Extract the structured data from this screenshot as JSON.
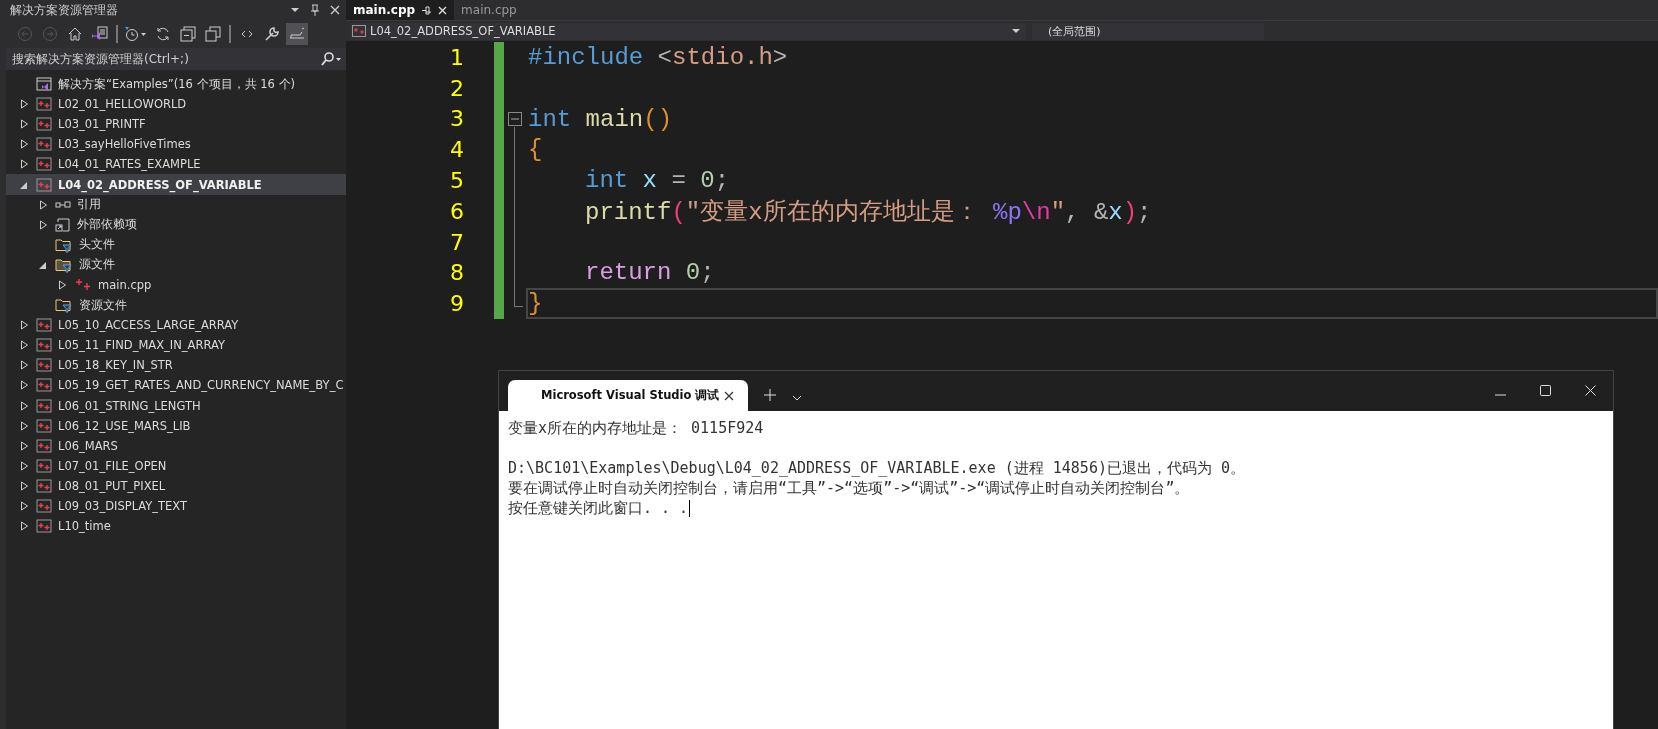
{
  "solution_explorer": {
    "title": "解决方案资源管理器",
    "toolbar": [
      {
        "kind": "back",
        "disabled": true,
        "on": false
      },
      {
        "kind": "forward",
        "disabled": true,
        "on": false
      },
      {
        "kind": "home",
        "on": false
      },
      {
        "kind": "solution",
        "on": false
      },
      {
        "kind": "history",
        "on": false,
        "separator_before": true
      },
      {
        "kind": "sync",
        "on": false
      },
      {
        "kind": "collapse",
        "on": false
      },
      {
        "kind": "copy",
        "on": false
      },
      {
        "kind": "code",
        "on": false,
        "separator_before": true
      },
      {
        "kind": "wrench",
        "on": false
      },
      {
        "kind": "preview",
        "on": true
      }
    ],
    "search": {
      "placeholder": "搜索解决方案资源管理器(Ctrl+;)"
    },
    "solution": {
      "label": "解决方案“Examples”(16 个项目，共 16 个)",
      "projects": [
        {
          "kind": "project",
          "label": "L02_01_HELLOWORLD",
          "expanded": false,
          "selected": false
        },
        {
          "kind": "project",
          "label": "L03_01_PRINTF",
          "expanded": false,
          "selected": false
        },
        {
          "kind": "project",
          "label": "L03_sayHelloFiveTimes",
          "expanded": false,
          "selected": false
        },
        {
          "kind": "project",
          "label": "L04_01_RATES_EXAMPLE",
          "expanded": false,
          "selected": false
        },
        {
          "kind": "project",
          "label": "L04_02_ADDRESS_OF_VARIABLE",
          "expanded": true,
          "selected": true,
          "children": [
            {
              "kind": "references",
              "label": "引用",
              "expanded": false,
              "selected": false
            },
            {
              "kind": "external",
              "label": "外部依赖项",
              "expanded": false,
              "selected": false
            },
            {
              "kind": "filter",
              "label": "头文件",
              "selected": false
            },
            {
              "kind": "filter",
              "label": "源文件",
              "expanded": true,
              "selected": false,
              "children": [
                {
                  "kind": "cpp",
                  "label": "main.cpp",
                  "expanded": false,
                  "selected": false
                }
              ]
            },
            {
              "kind": "filter",
              "label": "资源文件",
              "selected": false
            }
          ]
        },
        {
          "kind": "project",
          "label": "L05_10_ACCESS_LARGE_ARRAY",
          "expanded": false,
          "selected": false
        },
        {
          "kind": "project",
          "label": "L05_11_FIND_MAX_IN_ARRAY",
          "expanded": false,
          "selected": false
        },
        {
          "kind": "project",
          "label": "L05_18_KEY_IN_STR",
          "expanded": false,
          "selected": false
        },
        {
          "kind": "project",
          "label": "L05_19_GET_RATES_AND_CURRENCY_NAME_BY_C",
          "expanded": false,
          "selected": false
        },
        {
          "kind": "project",
          "label": "L06_01_STRING_LENGTH",
          "expanded": false,
          "selected": false
        },
        {
          "kind": "project",
          "label": "L06_12_USE_MARS_LIB",
          "expanded": false,
          "selected": false
        },
        {
          "kind": "project",
          "label": "L06_MARS",
          "expanded": false,
          "selected": false
        },
        {
          "kind": "project",
          "label": "L07_01_FILE_OPEN",
          "expanded": false,
          "selected": false
        },
        {
          "kind": "project",
          "label": "L08_01_PUT_PIXEL",
          "expanded": false,
          "selected": false
        },
        {
          "kind": "project",
          "label": "L09_03_DISPLAY_TEXT",
          "expanded": false,
          "selected": false
        },
        {
          "kind": "project",
          "label": "L10_time",
          "expanded": false,
          "selected": false
        }
      ]
    }
  },
  "editor": {
    "tabs": [
      {
        "label": "main.cpp",
        "selected": true
      },
      {
        "label": "main.cpp",
        "selected": false
      }
    ],
    "nav": {
      "project": "L04_02_ADDRESS_OF_VARIABLE",
      "scope": "(全局范围)"
    },
    "lines": [
      {
        "number": "1",
        "current": false,
        "indented": false,
        "tokens": [
          {
            "kind": "preproc",
            "text": "#include"
          },
          {
            "kind": "op",
            "text": " <"
          },
          {
            "kind": "header",
            "text": "stdio.h"
          },
          {
            "kind": "op",
            "text": ">"
          }
        ]
      },
      {
        "number": "2",
        "current": false
      },
      {
        "number": "3",
        "current": false,
        "indented": false,
        "collapsible": true,
        "tokens": [
          {
            "kind": "kw",
            "text": "int"
          },
          {
            "kind": "fn",
            "text": " main"
          },
          {
            "kind": "brace",
            "text": "()"
          }
        ]
      },
      {
        "number": "4",
        "current": false,
        "indented": false,
        "tokens": [
          {
            "kind": "brace",
            "text": "{"
          }
        ]
      },
      {
        "number": "5",
        "current": false,
        "indented": true,
        "tokens": [
          {
            "kind": "kw",
            "text": "int"
          },
          {
            "kind": "var",
            "text": " x"
          },
          {
            "kind": "op",
            "text": " ="
          },
          {
            "kind": "num",
            "text": " 0"
          },
          {
            "kind": "op",
            "text": ";"
          }
        ]
      },
      {
        "number": "6",
        "current": false,
        "indented": true,
        "tokens": [
          {
            "kind": "fn",
            "text": "printf"
          },
          {
            "kind": "paren",
            "text": "("
          },
          {
            "kind": "str",
            "text": "\"变量x所在的内存地址是："
          },
          {
            "kind": "fmt",
            "text": " %p"
          },
          {
            "kind": "esc",
            "text": "\\n"
          },
          {
            "kind": "str",
            "text": "\""
          },
          {
            "kind": "op",
            "text": ", &"
          },
          {
            "kind": "var",
            "text": "x"
          },
          {
            "kind": "paren",
            "text": ")"
          },
          {
            "kind": "op",
            "text": ";"
          }
        ]
      },
      {
        "number": "7",
        "current": false
      },
      {
        "number": "8",
        "current": false,
        "indented": true,
        "tokens": [
          {
            "kind": "ret",
            "text": "return"
          },
          {
            "kind": "num",
            "text": " 0"
          },
          {
            "kind": "op",
            "text": ";"
          }
        ]
      },
      {
        "number": "9",
        "current": true,
        "indented": false,
        "tokens": [
          {
            "kind": "brace",
            "text": "}"
          }
        ]
      }
    ]
  },
  "console": {
    "tab_title": "Microsoft Visual Studio 调试",
    "paragraphs": [
      [
        "变量x所在的内存地址是： 0115F924"
      ],
      [
        "D:\\BC101\\Examples\\Debug\\L04_02_ADDRESS_OF_VARIABLE.exe (进程 14856)已退出，代码为 0。",
        "要在调试停止时自动关闭控制台，请启用“工具”->“选项”->“调试”->“调试停止时自动关闭控制台”。",
        "按任意键关闭此窗口. . ."
      ]
    ]
  }
}
